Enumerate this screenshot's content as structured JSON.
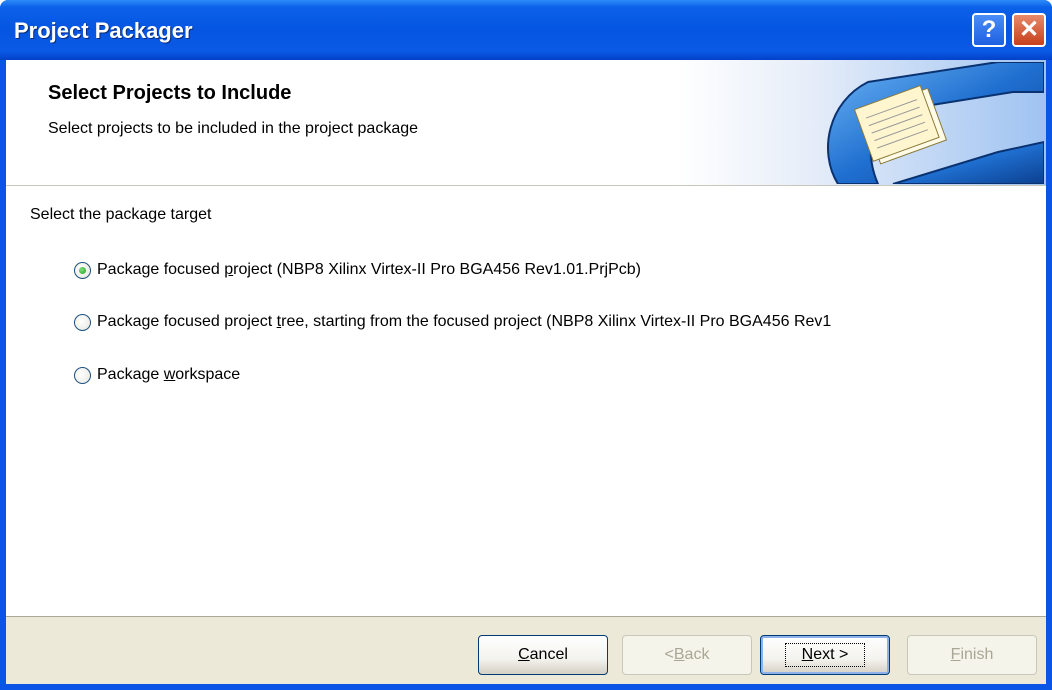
{
  "window": {
    "title": "Project Packager",
    "help_glyph": "?",
    "close_glyph": "✕"
  },
  "header": {
    "title": "Select Projects to Include",
    "subtitle": "Select projects to be included in the project package",
    "graphic_icon": "clamp-with-documents-icon"
  },
  "body": {
    "section_label": "Select the package target",
    "options": [
      {
        "pre": "Package focused ",
        "accel": "p",
        "post": "roject (NBP8 Xilinx Virtex-II Pro BGA456 Rev1.01.PrjPcb)",
        "checked": true
      },
      {
        "pre": "Package focused project ",
        "accel": "t",
        "post": "ree, starting from the focused project (NBP8 Xilinx Virtex-II Pro BGA456 Rev1",
        "checked": false
      },
      {
        "pre": "Package ",
        "accel": "w",
        "post": "orkspace",
        "checked": false
      }
    ]
  },
  "footer": {
    "cancel": {
      "pre": "",
      "accel": "C",
      "post": "ancel",
      "enabled": true
    },
    "back": {
      "pre": "< ",
      "accel": "B",
      "post": "ack",
      "enabled": false
    },
    "next": {
      "pre": "",
      "accel": "N",
      "post": "ext >",
      "enabled": true,
      "default": true
    },
    "finish": {
      "pre": "",
      "accel": "F",
      "post": "inish",
      "enabled": false
    }
  },
  "colors": {
    "titlebar": "#0555e2",
    "footer_bg": "#ece9d8",
    "radio_dot": "#21a121"
  }
}
